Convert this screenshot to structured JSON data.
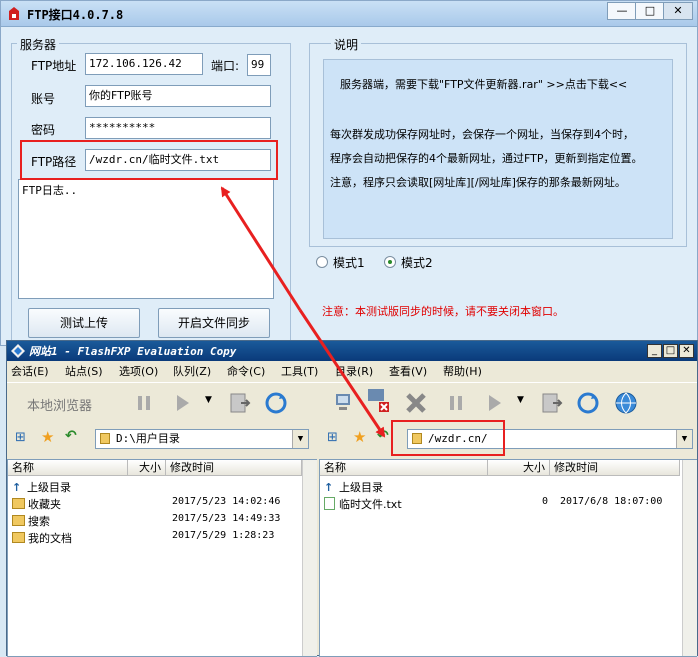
{
  "ftp_window": {
    "title": "FTP接口4.0.7.8",
    "controls": {
      "minimize": "—",
      "maximize": "□",
      "close": "✕"
    },
    "server_group": {
      "legend": "服务器",
      "ftp_addr_label": "FTP地址",
      "ftp_addr_value": "172.106.126.42",
      "port_label": "端口:",
      "port_value": "99",
      "account_label": "账号",
      "account_value": "你的FTP账号",
      "password_label": "密码",
      "password_value": "**********",
      "ftp_path_label": "FTP路径",
      "ftp_path_value": "/wzdr.cn/临时文件.txt",
      "log_text": "FTP日志..",
      "test_upload_button": "测试上传",
      "start_sync_button": "开启文件同步"
    },
    "description_group": {
      "legend": "说明",
      "line1": "服务器端，需要下载\"FTP文件更新器.rar\"  >>点击下载<<",
      "line2": "每次群发成功保存网址时，会保存一个网址，当保存到4个时，",
      "line3": "程序会自动把保存的4个最新网址，通过FTP，更新到指定位置。",
      "line4": "注意，程序只会读取[网址库][/网址库]保存的那条最新网址。"
    },
    "modes": {
      "mode1": "模式1",
      "mode2": "模式2",
      "selected": "mode2"
    },
    "notice": "注意：本测试版同步的时候，请不要关闭本窗口。"
  },
  "flashfxp_window": {
    "title": "网站1 - FlashFXP Evaluation Copy",
    "controls": {
      "minimize": "_",
      "maximize": "□",
      "close": "✕"
    },
    "menu": [
      "会话(E)",
      "站点(S)",
      "选项(O)",
      "队列(Z)",
      "命令(C)",
      "工具(T)",
      "目录(R)",
      "查看(V)",
      "帮助(H)"
    ],
    "local_browser_label": "本地浏览器",
    "local": {
      "path": "D:\\用户目录",
      "columns": {
        "name": "名称",
        "size": "大小",
        "modified": "修改时间"
      },
      "rows": [
        {
          "name": "上级目录",
          "size": "",
          "modified": ""
        },
        {
          "name": "收藏夹",
          "size": "",
          "modified": "2017/5/23 14:02:46"
        },
        {
          "name": "搜索",
          "size": "",
          "modified": "2017/5/23 14:49:33"
        },
        {
          "name": "我的文档",
          "size": "",
          "modified": "2017/5/29 1:28:23"
        }
      ]
    },
    "remote": {
      "path": "/wzdr.cn/",
      "columns": {
        "name": "名称",
        "size": "大小",
        "modified": "修改时间"
      },
      "rows": [
        {
          "name": "上级目录",
          "size": "",
          "modified": ""
        },
        {
          "name": "临时文件.txt",
          "size": "0",
          "modified": "2017/6/8 18:07:00"
        }
      ]
    }
  },
  "colors": {
    "accent_red": "#e82020",
    "notice_red": "#e00000",
    "title_blue": "#0a3a7a"
  }
}
